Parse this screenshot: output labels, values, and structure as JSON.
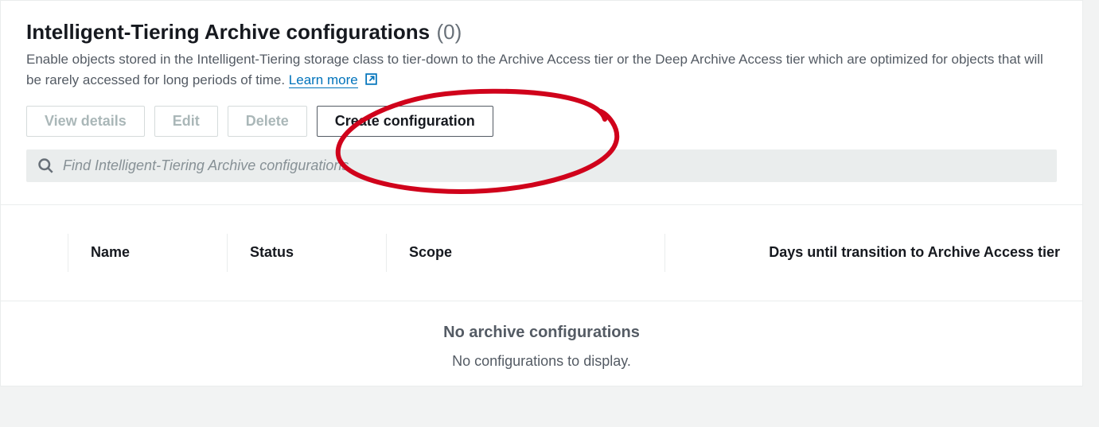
{
  "header": {
    "title": "Intelligent-Tiering Archive configurations",
    "count": "(0)",
    "description_part1": "Enable objects stored in the Intelligent-Tiering storage class to tier-down to the Archive Access tier or the Deep Archive Access tier which are optimized for objects that will be rarely accessed for long periods of time. ",
    "learn_more": "Learn more"
  },
  "buttons": {
    "view_details": "View details",
    "edit": "Edit",
    "delete": "Delete",
    "create": "Create configuration"
  },
  "search": {
    "placeholder": "Find Intelligent-Tiering Archive configurations"
  },
  "table": {
    "columns": {
      "name": "Name",
      "status": "Status",
      "scope": "Scope",
      "days": "Days until transition to Archive Access tier"
    },
    "empty_title": "No archive configurations",
    "empty_sub": "No configurations to display."
  }
}
